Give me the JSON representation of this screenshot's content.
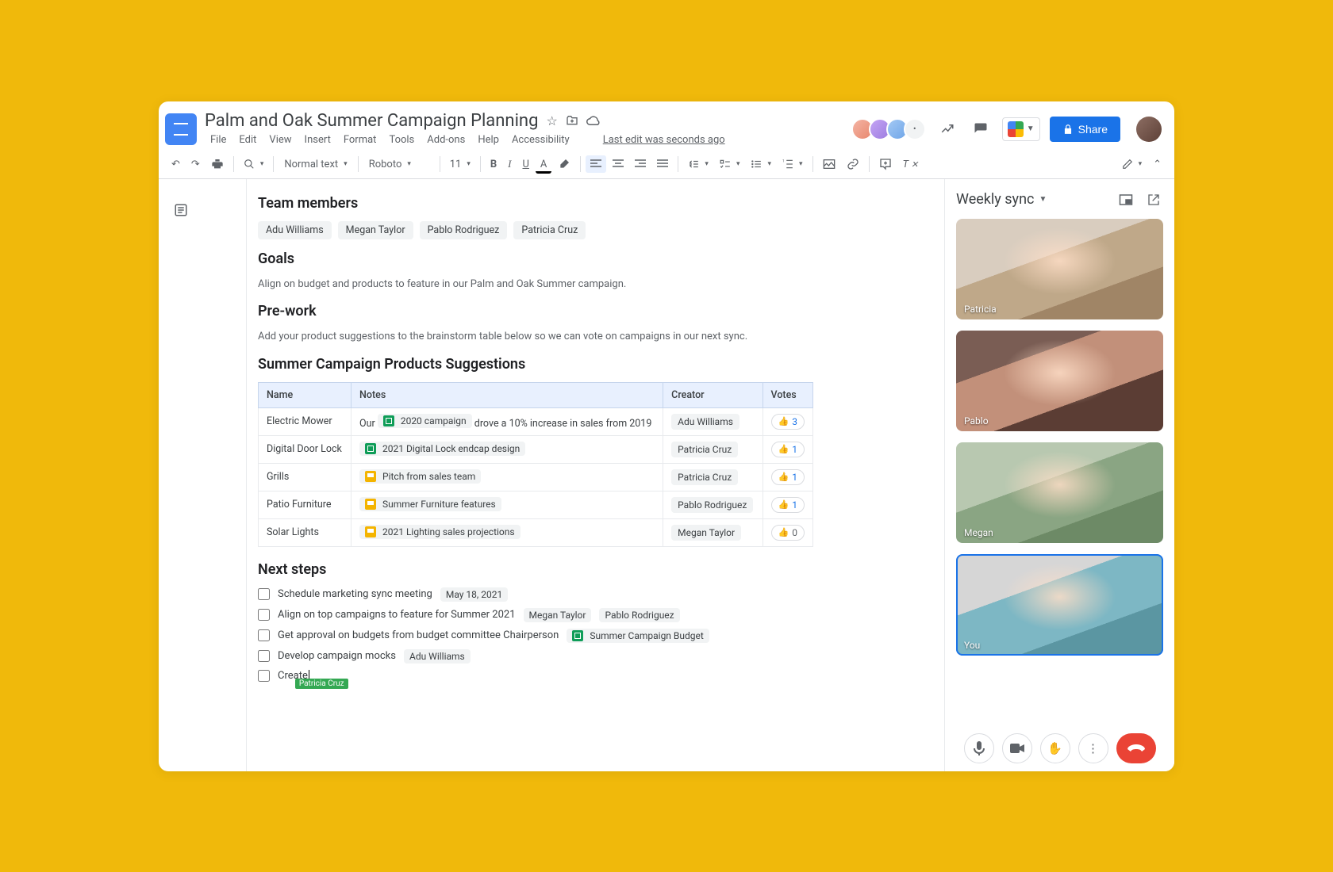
{
  "header": {
    "title": "Palm and Oak Summer Campaign Planning",
    "menus": [
      "File",
      "Edit",
      "View",
      "Insert",
      "Format",
      "Tools",
      "Add-ons",
      "Help",
      "Accessibility"
    ],
    "last_edit": "Last edit was seconds ago",
    "share_label": "Share"
  },
  "toolbar": {
    "style": "Normal text",
    "font": "Roboto",
    "size": "11"
  },
  "doc": {
    "sections": {
      "team_members": {
        "heading": "Team members",
        "members": [
          "Adu Williams",
          "Megan Taylor",
          "Pablo Rodriguez",
          "Patricia Cruz"
        ]
      },
      "goals": {
        "heading": "Goals",
        "text": "Align on budget and products to feature in our Palm and Oak Summer campaign."
      },
      "prework": {
        "heading": "Pre-work",
        "text": "Add your product suggestions to the brainstorm table below so we can vote on campaigns in our next sync."
      },
      "suggestions": {
        "heading": "Summer Campaign Products Suggestions",
        "columns": [
          "Name",
          "Notes",
          "Creator",
          "Votes"
        ],
        "rows": [
          {
            "name": "Electric Mower",
            "pre": "Our ",
            "link_type": "sheets",
            "link": "2020 campaign",
            "post": " drove a 10% increase in sales from 2019",
            "creator": "Adu Williams",
            "votes": 3,
            "zero": false
          },
          {
            "name": "Digital Door Lock",
            "pre": "",
            "link_type": "sheets",
            "link": "2021 Digital Lock endcap design",
            "post": "",
            "creator": "Patricia Cruz",
            "votes": 1,
            "zero": false
          },
          {
            "name": "Grills",
            "pre": "",
            "link_type": "slides",
            "link": "Pitch from sales team",
            "post": "",
            "creator": "Patricia Cruz",
            "votes": 1,
            "zero": false
          },
          {
            "name": "Patio Furniture",
            "pre": "",
            "link_type": "slides",
            "link": "Summer Furniture features",
            "post": "",
            "creator": "Pablo Rodriguez",
            "votes": 1,
            "zero": false
          },
          {
            "name": "Solar Lights",
            "pre": "",
            "link_type": "slides",
            "link": "2021 Lighting sales projections",
            "post": "",
            "creator": "Megan Taylor",
            "votes": 0,
            "zero": true
          }
        ]
      },
      "next_steps": {
        "heading": "Next steps",
        "items": [
          {
            "text": "Schedule marketing sync meeting",
            "chips": [
              {
                "type": "plain",
                "label": "May 18, 2021"
              }
            ]
          },
          {
            "text": "Align on top campaigns to feature for Summer 2021",
            "chips": [
              {
                "type": "plain",
                "label": "Megan Taylor"
              },
              {
                "type": "plain",
                "label": "Pablo Rodriguez"
              }
            ]
          },
          {
            "text": "Get approval on budgets from budget committee Chairperson",
            "chips": [
              {
                "type": "sheets",
                "label": "Summer Campaign Budget"
              }
            ]
          },
          {
            "text": "Develop campaign mocks",
            "chips": [
              {
                "type": "plain",
                "label": "Adu Williams"
              }
            ]
          },
          {
            "text": "Create",
            "chips": [],
            "cursor": true,
            "cursor_tag": "Patricia Cruz"
          }
        ]
      }
    }
  },
  "meet": {
    "title": "Weekly sync",
    "participants": [
      {
        "name": "Patricia",
        "self": false,
        "bg": "t1"
      },
      {
        "name": "Pablo",
        "self": false,
        "bg": "t2"
      },
      {
        "name": "Megan",
        "self": false,
        "bg": "t3"
      },
      {
        "name": "You",
        "self": true,
        "bg": "t4"
      }
    ]
  }
}
